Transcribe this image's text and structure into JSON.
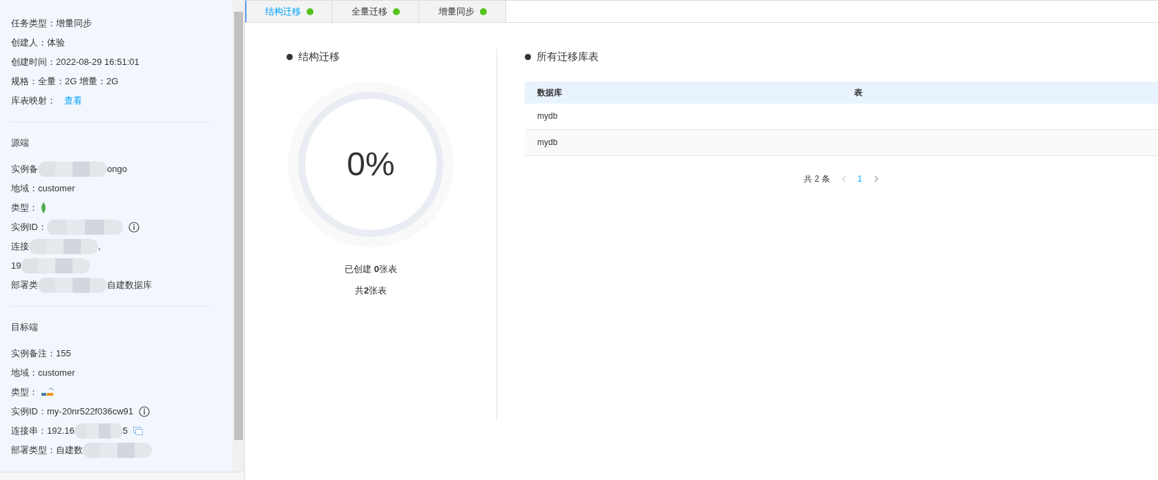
{
  "info": [
    {
      "label": "任务类型：",
      "value": "增量同步"
    },
    {
      "label": "创建人：",
      "value": "体验"
    },
    {
      "label": "创建时间：",
      "value": "2022-08-29 16:51:01"
    },
    {
      "label": "规格：",
      "value": "全量：2G 增量：2G"
    },
    {
      "label": "库表映射：",
      "link": "查看"
    }
  ],
  "source": {
    "title": "源端",
    "rows": [
      {
        "kind": "blurred",
        "before": "实例备",
        "after": "ongo"
      },
      {
        "kind": "text",
        "label": "地域：",
        "value": "customer"
      },
      {
        "kind": "type",
        "label": "类型：",
        "logo": {
          "kind": "mongodb"
        }
      },
      {
        "kind": "info",
        "label": "实例ID："
      },
      {
        "kind": "blurred",
        "before": "连接",
        "after": ","
      },
      {
        "kind": "blurred",
        "before": "19",
        "after": ""
      },
      {
        "kind": "blurred",
        "before": "部署类",
        "after": "自建数据库"
      }
    ]
  },
  "target": {
    "title": "目标端",
    "rows": [
      {
        "kind": "text",
        "label": "实例备注：",
        "value": "155"
      },
      {
        "kind": "text",
        "label": "地域：",
        "value": "customer"
      },
      {
        "kind": "type",
        "label": "类型：",
        "logo": {
          "kind": "mysql"
        }
      },
      {
        "kind": "info",
        "label": "实例ID：",
        "value": "my-20nr522f036cw91"
      },
      {
        "kind": "copy",
        "label": "连接串：",
        "value": "192.16",
        "after": "5"
      },
      {
        "kind": "blurred",
        "before": "部署类型：自建数",
        "after": ""
      }
    ]
  },
  "tabs": [
    {
      "label": "结构迁移",
      "selected": true,
      "color": "#52c41a"
    },
    {
      "label": "全量迁移",
      "selected": false,
      "color": "#52c41a"
    },
    {
      "label": "增量同步",
      "selected": false,
      "color": "#52c41a"
    }
  ],
  "progress": {
    "title": "结构迁移",
    "percent": "0%",
    "level": 0,
    "created": "已创建 **0**张表",
    "total": "共**2**张表"
  },
  "tables": {
    "title": "所有迁移库表",
    "columns": [
      "数据库",
      "表"
    ],
    "rows": [
      [
        "mydb",
        ""
      ],
      [
        "mydb",
        ""
      ]
    ],
    "pagination": {
      "total": "共 2 条",
      "pages": [
        {
          "label": "1",
          "selected": true
        }
      ]
    }
  }
}
